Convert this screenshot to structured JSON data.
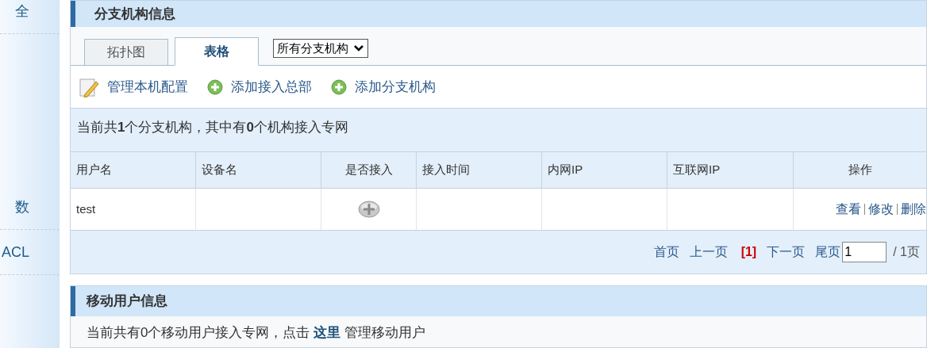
{
  "sidebar": {
    "items": [
      {
        "label": "全"
      },
      {
        "label": "数"
      },
      {
        "label": "ACL"
      }
    ]
  },
  "branch_panel": {
    "title": "分支机构信息",
    "tabs": [
      {
        "label": "拓扑图",
        "selected": false
      },
      {
        "label": "表格",
        "selected": true
      }
    ],
    "filter": {
      "value": "所有分支机构"
    },
    "actions": [
      {
        "kind": "edit",
        "label": "管理本机配置"
      },
      {
        "kind": "add",
        "label": "添加接入总部"
      },
      {
        "kind": "add",
        "label": "添加分支机构"
      }
    ],
    "summary": "当前共**1**个分支机构，其中有**0**个机构接入专网",
    "table": {
      "columns": [
        "用户名",
        "设备名",
        "是否接入",
        "接入时间",
        "内网IP",
        "互联网IP",
        "操作"
      ],
      "rows": [
        {
          "username": "test",
          "connected": false,
          "operations": [
            "查看",
            "修改",
            "删除"
          ]
        }
      ]
    },
    "pagination": {
      "first": "首页",
      "prev": "上一页",
      "current": "[1]",
      "next": "下一页",
      "last": "尾页",
      "page_input": "1",
      "total": "/ 1页"
    }
  },
  "mobile_panel": {
    "title": "移动用户信息",
    "text_before": "当前共有0个移动用户接入专网，点击",
    "link": "这里",
    "text_after": "管理移动用户"
  }
}
